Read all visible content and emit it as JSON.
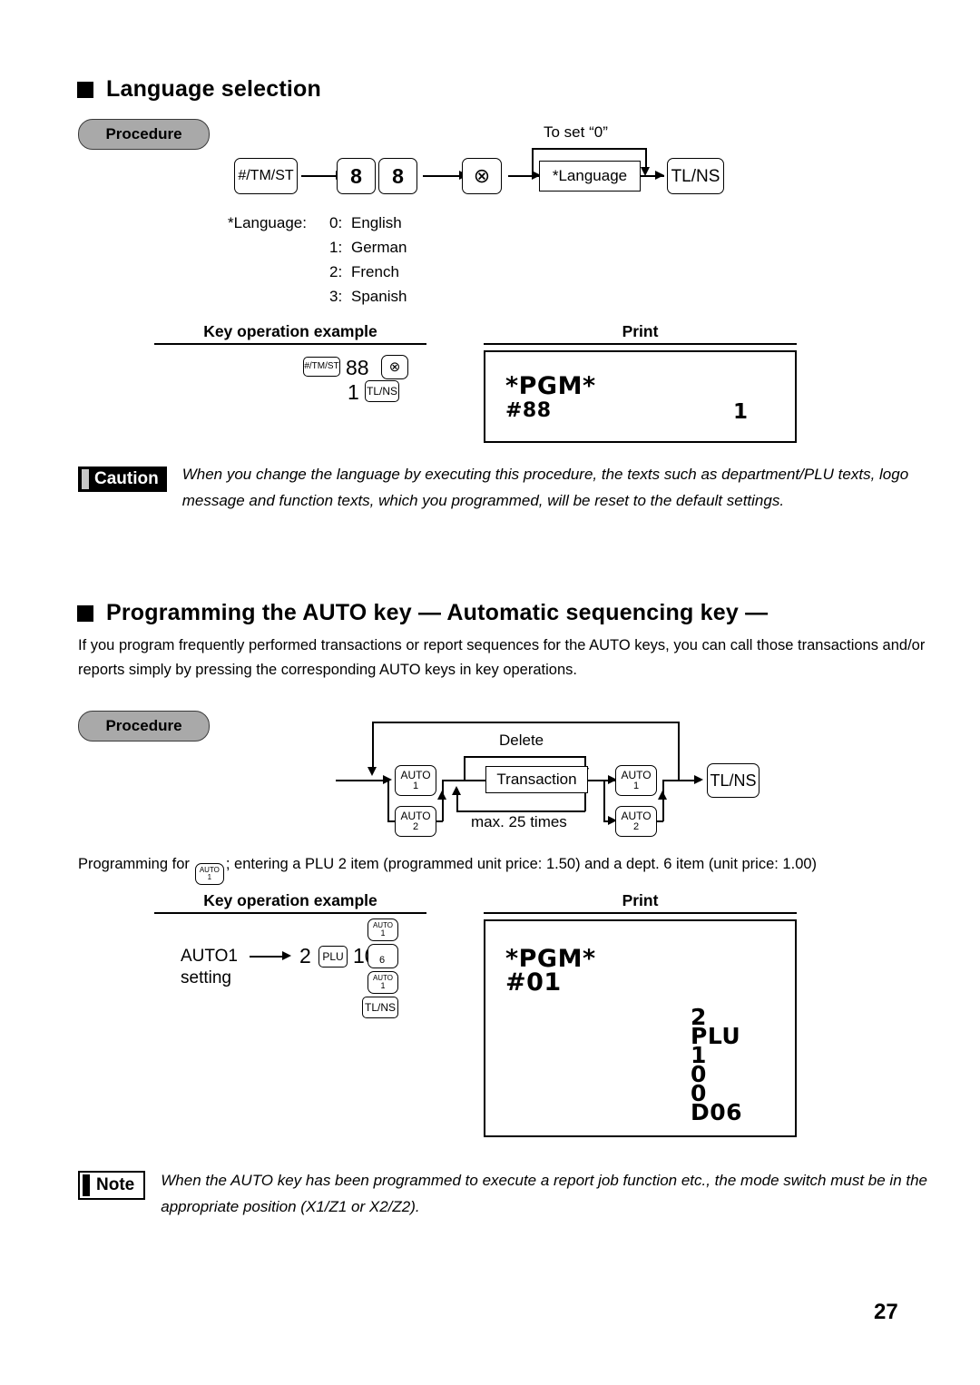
{
  "page": {
    "number": "27"
  },
  "section1": {
    "heading": "Language selection",
    "procedure_label": "Procedure",
    "diagram": {
      "keys": {
        "tmst": "#/TM/ST",
        "eight_a": "8",
        "eight_b": "8",
        "multiply": "⊗",
        "tlns": "TL/NS"
      },
      "language_box": "*Language",
      "loop_label": "To set “0”"
    },
    "language_note_label": "*Language:",
    "language_options": [
      {
        "code": "0:",
        "name": "English"
      },
      {
        "code": "1:",
        "name": "German"
      },
      {
        "code": "2:",
        "name": "French"
      },
      {
        "code": "3:",
        "name": "Spanish"
      }
    ],
    "columns": {
      "key_operation": "Key operation example",
      "print": "Print"
    },
    "key_operation": {
      "key_tmst": "#/TM/ST",
      "digits_88": "88",
      "key_multiply": "⊗",
      "digit_1": "1",
      "key_tlns": "TL/NS"
    },
    "print_receipt": {
      "line1": "*PGM*",
      "line2_left": "#88",
      "line2_right": "1"
    },
    "caution": {
      "badge": "Caution",
      "text": "When you change the language by executing this procedure, the texts such as department/PLU texts, logo message and function texts, which you programmed, will be reset to the default settings."
    }
  },
  "section2": {
    "heading": "Programming the AUTO key  — Automatic sequencing key —",
    "intro": "If you program frequently performed transactions or report sequences for the AUTO keys, you can call those transactions and/or reports simply by pressing the corresponding AUTO keys in key operations.",
    "procedure_label": "Procedure",
    "diagram": {
      "auto1_left_l1": "AUTO",
      "auto1_left_l2": "1",
      "auto2_left_l1": "AUTO",
      "auto2_left_l2": "2",
      "transaction_box": "Transaction",
      "auto1_right_l1": "AUTO",
      "auto1_right_l2": "1",
      "auto2_right_l1": "AUTO",
      "auto2_right_l2": "2",
      "tlns": "TL/NS",
      "delete_label": "Delete",
      "max_label": "max. 25 times"
    },
    "programming_for": {
      "prefix": "Programming for",
      "key_auto_l1": "AUTO",
      "key_auto_l2": "1",
      "suffix": "; entering a PLU 2 item (programmed unit price: 1.50) and a dept. 6 item (unit price: 1.00)"
    },
    "columns": {
      "key_operation": "Key operation example",
      "print": "Print"
    },
    "key_operation": {
      "label_line1": "AUTO1",
      "label_line2": "setting",
      "digit_2": "2",
      "key_plu": "PLU",
      "digits_100": "100",
      "stack": [
        {
          "l1": "AUTO",
          "l2": "1"
        },
        {
          "l1": "",
          "l2": "6"
        },
        {
          "l1": "AUTO",
          "l2": "1"
        },
        {
          "l1": "TL/NS",
          "l2": ""
        }
      ]
    },
    "print_receipt": {
      "line1": "*PGM*",
      "line2": "#01",
      "right_lines": [
        "2",
        "PLU",
        "1",
        "0",
        "0",
        "D06"
      ]
    },
    "note": {
      "badge": "Note",
      "text": "When the AUTO key has been programmed to execute a report job function etc., the mode switch must be in the appropriate position (X1/Z1 or X2/Z2)."
    }
  }
}
